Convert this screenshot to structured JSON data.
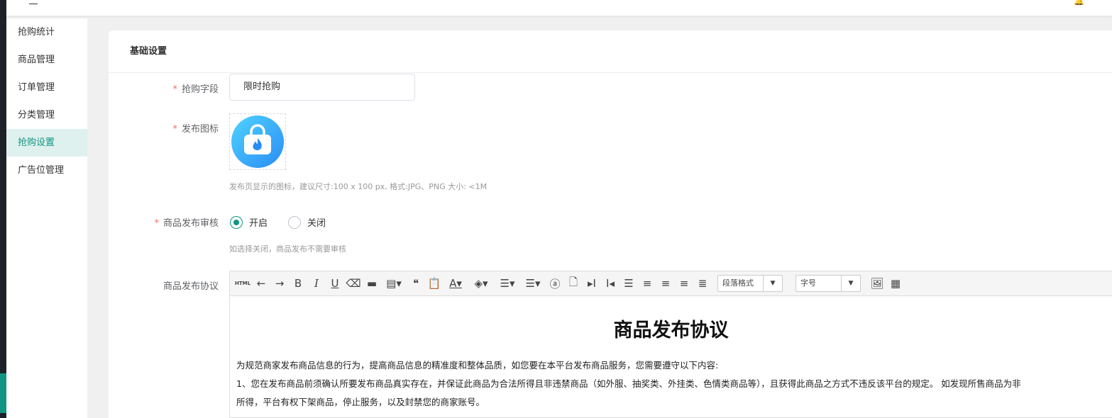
{
  "sidebar": {
    "items": [
      "抢购统计",
      "商品管理",
      "订单管理",
      "分类管理",
      "抢购设置",
      "广告位管理"
    ],
    "active": 4
  },
  "card": {
    "title": "基础设置"
  },
  "form": {
    "field_label": "抢购字段",
    "field_value": "限时抢购",
    "icon_label": "发布图标",
    "icon_hint": "发布页显示的图标，建议尺寸:100 x 100 px, 格式:JPG、PNG 大小: <1M",
    "review_label": "商品发布审核",
    "review_on": "开启",
    "review_off": "关闭",
    "review_hint": "如选择关闭，商品发布不需要审核",
    "agreement_label": "商品发布协议"
  },
  "editor": {
    "html_btn": "HTML",
    "paragraph_select": "段落格式",
    "fontsize_select": "字号",
    "title": "商品发布协议",
    "p1": "为规范商家发布商品信息的行为，提高商品信息的精准度和整体品质，如您要在本平台发布商品服务，您需要遵守以下内容:",
    "p2": "1、您在发布商品前须确认所要发布商品真实存在，并保证此商品为合法所得且非违禁商品（如外服、抽奖类、外挂类、色情类商品等），且获得此商品之方式不违反该平台的规定。 如发现所售商品为非",
    "p3": "所得，平台有权下架商品，停止服务，以及封禁您的商家账号。"
  },
  "colors": {
    "accent": "#0f9582",
    "active_bg": "#dff1ee"
  }
}
